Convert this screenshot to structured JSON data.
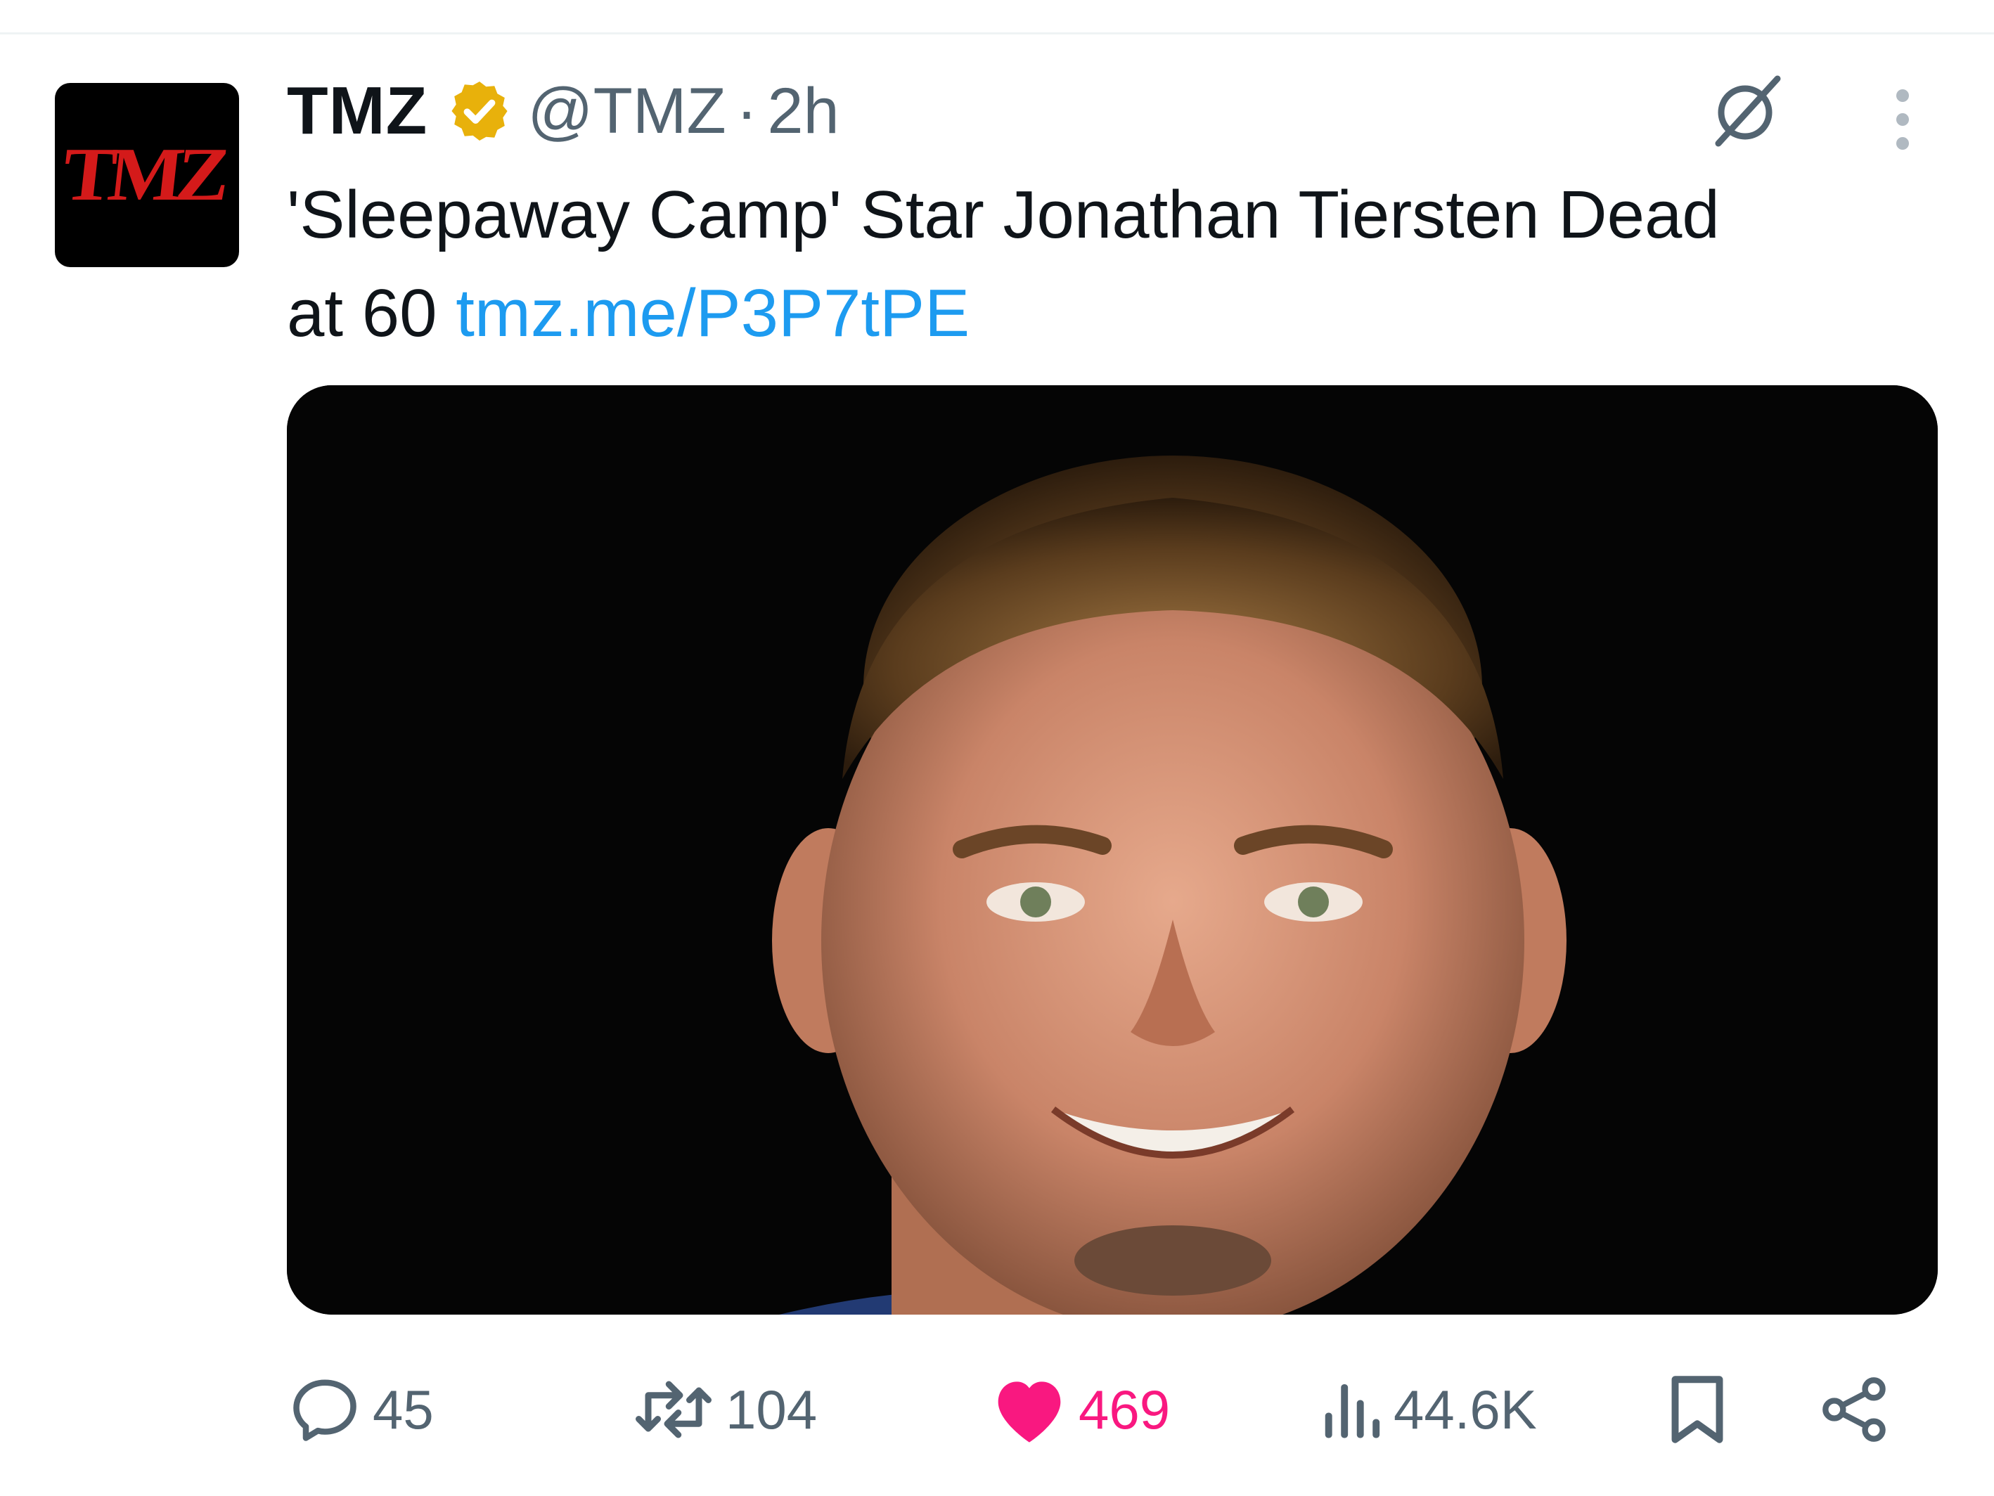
{
  "post": {
    "avatar_text": "TMZ",
    "display_name": "TMZ",
    "verified_icon": "verified-badge-icon",
    "handle": "@TMZ",
    "separator": "·",
    "time": "2h",
    "text_line1": "'Sleepaway Camp' Star Jonathan Tiersten Dead",
    "text_line2": "at 60",
    "link": "tmz.me/P3P7tPE",
    "media_description_icon": "portrait-photo"
  },
  "actions": {
    "replies": "45",
    "reposts": "104",
    "likes": "469",
    "views": "44.6K"
  },
  "colors": {
    "link": "#1d9bf0",
    "like": "#f91880",
    "muted": "#536471",
    "verified": "#e8b10b",
    "text": "#0f1419"
  },
  "icons": [
    "grok-icon",
    "more-icon",
    "reply-icon",
    "repost-icon",
    "like-icon",
    "views-icon",
    "bookmark-icon",
    "share-icon"
  ]
}
